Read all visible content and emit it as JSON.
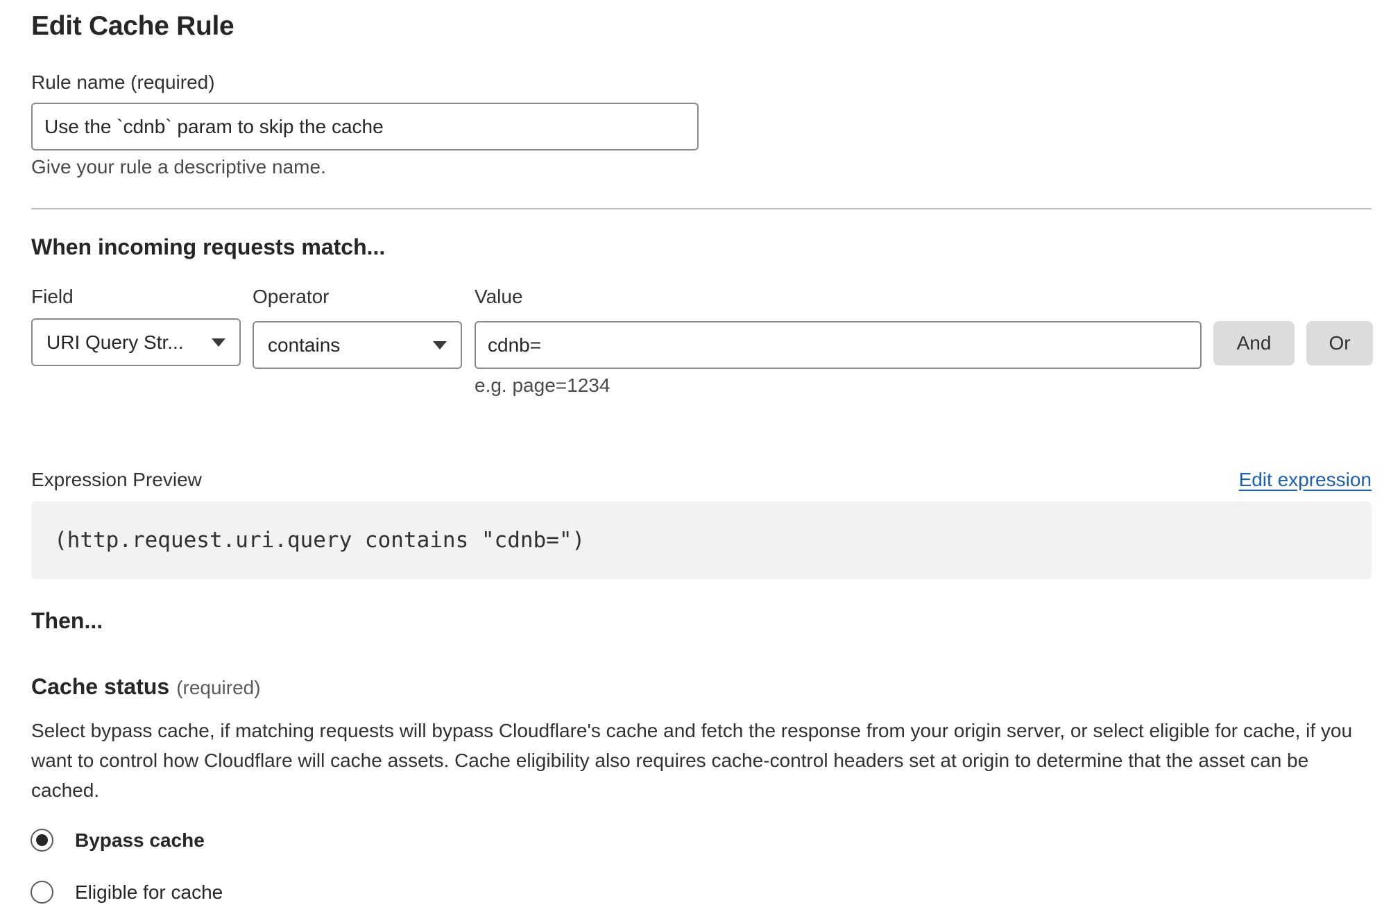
{
  "page": {
    "title": "Edit Cache Rule"
  },
  "rule_name": {
    "label": "Rule name (required)",
    "value": "Use the `cdnb` param to skip the cache",
    "help": "Give your rule a descriptive name."
  },
  "match": {
    "heading": "When incoming requests match...",
    "field_label": "Field",
    "operator_label": "Operator",
    "value_label": "Value",
    "field_value": "URI Query Str...",
    "operator_value": "contains",
    "value_value": "cdnb=",
    "value_hint": "e.g. page=1234",
    "and_label": "And",
    "or_label": "Or"
  },
  "expression": {
    "label": "Expression Preview",
    "edit_link": "Edit expression",
    "code": "(http.request.uri.query contains \"cdnb=\")"
  },
  "then": {
    "heading": "Then..."
  },
  "cache_status": {
    "heading": "Cache status",
    "required": "(required)",
    "description": "Select bypass cache, if matching requests will bypass Cloudflare's cache and fetch the response from your origin server, or select eligible for cache, if you want to control how Cloudflare will cache assets. Cache eligibility also requires cache-control headers set at origin to determine that the asset can be cached.",
    "options": [
      {
        "label": "Bypass cache",
        "selected": true
      },
      {
        "label": "Eligible for cache",
        "selected": false
      }
    ]
  }
}
